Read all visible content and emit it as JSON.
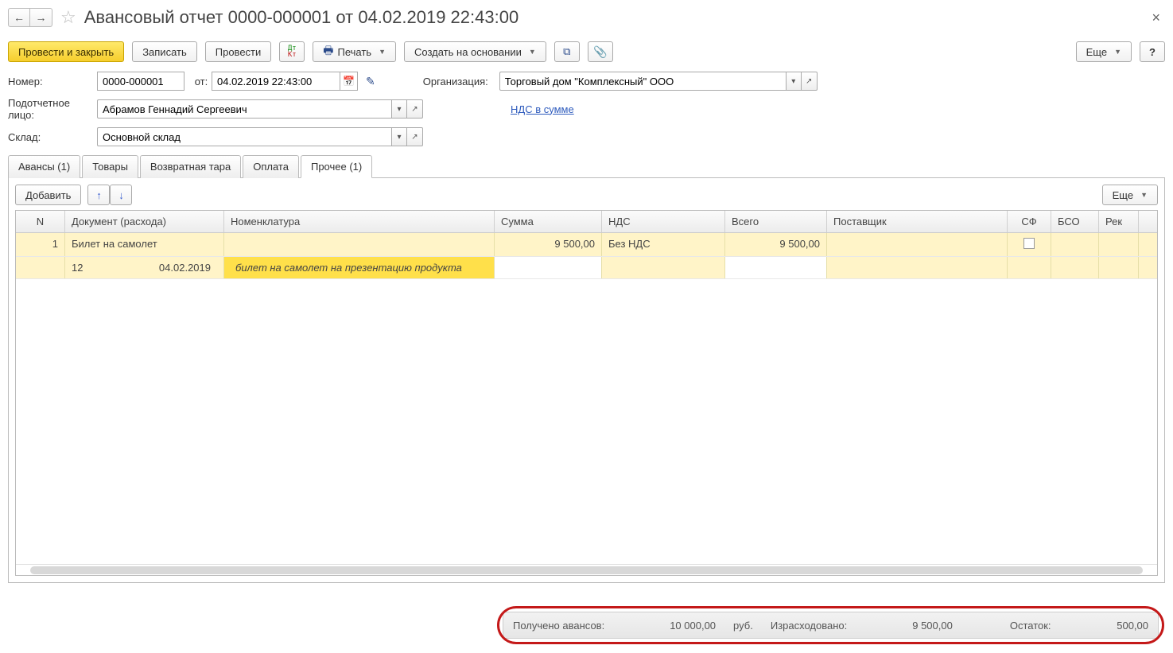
{
  "title": "Авансовый отчет 0000-000001 от 04.02.2019 22:43:00",
  "toolbar": {
    "post_close": "Провести и закрыть",
    "save": "Записать",
    "post": "Провести",
    "print": "Печать",
    "create_based": "Создать на основании",
    "more": "Еще",
    "help": "?"
  },
  "form": {
    "number_lbl": "Номер:",
    "number": "0000-000001",
    "from_lbl": "от:",
    "date": "04.02.2019 22:43:00",
    "org_lbl": "Организация:",
    "org": "Торговый дом \"Комплексный\" ООО",
    "person_lbl": "Подотчетное лицо:",
    "person": "Абрамов Геннадий Сергеевич",
    "vat_link": "НДС в сумме",
    "warehouse_lbl": "Склад:",
    "warehouse": "Основной склад"
  },
  "tabs": {
    "advances": "Авансы (1)",
    "goods": "Товары",
    "returnable": "Возвратная тара",
    "payment": "Оплата",
    "other": "Прочее (1)"
  },
  "tab_actions": {
    "add": "Добавить",
    "more": "Еще"
  },
  "grid": {
    "headers": {
      "n": "N",
      "doc": "Документ (расхода)",
      "nom": "Номенклатура",
      "sum": "Сумма",
      "nds": "НДС",
      "total": "Всего",
      "supplier": "Поставщик",
      "sf": "СФ",
      "bso": "БСО",
      "rek": "Рек"
    },
    "row": {
      "n": "1",
      "doc": "Билет на самолет",
      "nom": "",
      "sum": "9 500,00",
      "nds": "Без НДС",
      "total": "9 500,00",
      "supplier": "",
      "doc_num": "12",
      "doc_date": "04.02.2019",
      "nom_detail": "билет на самолет на презентацию продукта"
    }
  },
  "summary": {
    "received_lbl": "Получено авансов:",
    "received_val": "10 000,00",
    "currency": "руб.",
    "spent_lbl": "Израсходовано:",
    "spent_val": "9 500,00",
    "balance_lbl": "Остаток:",
    "balance_val": "500,00"
  }
}
